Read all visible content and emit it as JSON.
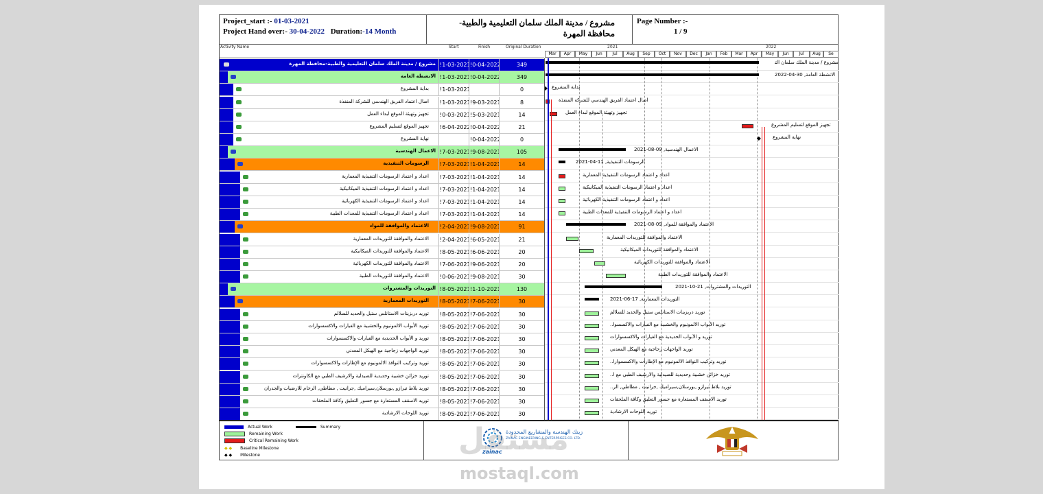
{
  "header": {
    "start_label": "Project_start  :-",
    "start_value": "01-03-2021",
    "handover_label": "Project Hand over:-",
    "handover_value": "30-04-2022",
    "duration_label": "Duration:",
    "duration_value": "-14 Month",
    "title": "مشروع / مدينة الملك سلمان التعليمية والطبية-محافظة المهرة",
    "page_label": "Page Number :-",
    "page_value": "1 / 9"
  },
  "columns": {
    "activity": "Activity Name",
    "start": "Start",
    "finish": "Finish",
    "duration": "Original Duration"
  },
  "timeline": {
    "years": [
      "2021",
      "2022"
    ],
    "months": [
      "Mar",
      "Apr",
      "May",
      "Jun",
      "Jul",
      "Aug",
      "Sep",
      "Oct",
      "Nov",
      "Dec",
      "Jan",
      "Feb",
      "Mar",
      "Apr",
      "May",
      "Jun",
      "Jul",
      "Aug",
      "Se"
    ]
  },
  "rows": [
    {
      "type": "project",
      "name": "مشروع / مدينة الملك سلمان التعليمية والطبية-محافظة المهرة",
      "start": "!1-03-2021",
      "finish": "!0-04-2022",
      "dur": "349"
    },
    {
      "type": "wbs1",
      "name": "الانشطة العامة",
      "start": "!1-03-2021",
      "finish": "!0-04-2022",
      "dur": "349"
    },
    {
      "type": "task",
      "name": "بداية المشروع",
      "start": "!1-03-2021",
      "finish": "",
      "dur": "0"
    },
    {
      "type": "task",
      "name": "اصال اعتماد الفريق الهندسي للشركة المنفذة",
      "start": "!1-03-2021",
      "finish": "!9-03-2021",
      "dur": "8"
    },
    {
      "type": "task",
      "name": "تجهيز وتهيئة الموقع لبداء العمل",
      "start": "!0-03-2021",
      "finish": "!5-03-2021",
      "dur": "14"
    },
    {
      "type": "task",
      "name": "تجهيز الموقع لتسليم المشروع",
      "start": "!6-04-2022",
      "finish": "!0-04-2022",
      "dur": "21"
    },
    {
      "type": "task",
      "name": "نهاية المشروع",
      "start": "",
      "finish": "!0-04-2022",
      "dur": "0"
    },
    {
      "type": "wbs1",
      "name": "الاعمال الهندسية",
      "start": "!7-03-2021",
      "finish": "!9-08-2021",
      "dur": "105"
    },
    {
      "type": "wbs2",
      "name": "الرسومات التنفيذية",
      "start": "!7-03-2021",
      "finish": "!1-04-2021",
      "dur": "14"
    },
    {
      "type": "task2",
      "name": "اعداد و اعتماد الرسومات التنفيذية المعمارية",
      "start": "!7-03-2021",
      "finish": "!1-04-2021",
      "dur": "14"
    },
    {
      "type": "task2",
      "name": "اعداد و اعتماد الرسومات التنفيذية الميكانيكية",
      "start": "!7-03-2021",
      "finish": "!1-04-2021",
      "dur": "14"
    },
    {
      "type": "task2",
      "name": "اعداد و اعتماد الرسومات التنفيذية الكهربائية",
      "start": "!7-03-2021",
      "finish": "!1-04-2021",
      "dur": "14"
    },
    {
      "type": "task2",
      "name": "اعداد و اعتماد الرسومات التنفيذية للمعدات الطبية",
      "start": "!7-03-2021",
      "finish": "!1-04-2021",
      "dur": "14"
    },
    {
      "type": "wbs2",
      "name": "الاعتماد والموافقة للمواد",
      "start": "!2-04-2021",
      "finish": "!9-08-2021",
      "dur": "91"
    },
    {
      "type": "task2",
      "name": "الاعتماد والموافقة للتوريدات المعمارية",
      "start": "!2-04-2021",
      "finish": "!6-05-2021",
      "dur": "21"
    },
    {
      "type": "task2",
      "name": "الاعتماد والموافقة للتوريدات الميكانيكية",
      "start": "!8-05-2021",
      "finish": "!6-06-2021",
      "dur": "20"
    },
    {
      "type": "task2",
      "name": "الاعتماد والموافقة للتوريدات الكهربائية",
      "start": "!7-06-2021",
      "finish": "!9-06-2021",
      "dur": "20"
    },
    {
      "type": "task2",
      "name": "الاعتماد والموافقة للتوريدات الطبية",
      "start": "!0-06-2021",
      "finish": "!9-08-2021",
      "dur": "30"
    },
    {
      "type": "wbs1",
      "name": "التوريدات والمشتروات",
      "start": "!8-05-2021",
      "finish": "!1-10-2021",
      "dur": "130"
    },
    {
      "type": "wbs2",
      "name": "التوريدات المعمارية",
      "start": "!8-05-2021",
      "finish": "!7-06-2021",
      "dur": "30"
    },
    {
      "type": "task2",
      "name": "توريد دربزينات الاستانلس ستيل والحديد للسلالم",
      "start": "!8-05-2021",
      "finish": "!7-06-2021",
      "dur": "30"
    },
    {
      "type": "task2",
      "name": "توريد الأبواب الالمونيوم والخشبية مع الفيارات والاكسسوارات",
      "start": "!8-05-2021",
      "finish": "!7-06-2021",
      "dur": "30"
    },
    {
      "type": "task2",
      "name": "توريد و الأبواب الحديدية مع الفيارات والاكسسوارات",
      "start": "!8-05-2021",
      "finish": "!7-06-2021",
      "dur": "30"
    },
    {
      "type": "task2",
      "name": "توريد الواجهات زجاجية مع الهيكل المعدني",
      "start": "!8-05-2021",
      "finish": "!7-06-2021",
      "dur": "30"
    },
    {
      "type": "task2",
      "name": "توريد وتركيب النوافذ الالمونيوم مع الإطارات والاكسسوارات",
      "start": "!8-05-2021",
      "finish": "!7-06-2021",
      "dur": "30"
    },
    {
      "type": "task2",
      "name": "توريد خزائن خشبية وحديدية للصيدلية والارشيف الطبي مع الكاونترات",
      "start": "!8-05-2021",
      "finish": "!7-06-2021",
      "dur": "30"
    },
    {
      "type": "task2",
      "name": "توريد بلاط تيرازو ,بورسلان,سيراميك ,جرانيت , مطاطي, الرخام للارضيات والجدران",
      "start": "!8-05-2021",
      "finish": "!7-06-2021",
      "dur": "30"
    },
    {
      "type": "task2",
      "name": "توريد الاسقف المستعارة مع جسور التعليق وكافة الملحقات",
      "start": "!8-05-2021",
      "finish": "!7-06-2021",
      "dur": "30"
    },
    {
      "type": "task2",
      "name": "توريد اللوحات الارشادية",
      "start": "!8-05-2021",
      "finish": "!7-06-2021",
      "dur": "30"
    }
  ],
  "gantt_labels": [
    "مشروع / مدينة الملك سلمان التعليمية والطبية, 30-04-2022",
    "الانشطة العامة, 30-04-2022",
    "بداية المشروع",
    "اصال اعتماد الفريق الهندسي للشركة المنفذة",
    "تجهيز وتهيئة الموقع لبداء العمل",
    "تجهيز الموقع لتسليم المشروع",
    "نهاية المشروع",
    "الاعمال الهندسية, 09-08-2021",
    "الرسومات التنفيذية, 11-04-2021",
    "اعداد و اعتماد الرسومات التنفيذية المعمارية",
    "اعداد و اعتماد الرسومات التنفيذية الميكانيكية",
    "اعداد و اعتماد الرسومات التنفيذية الكهربائية",
    "اعداد و اعتماد الرسومات التنفيذية للمعدات الطبية",
    "الاعتماد والموافقة للمواد, 09-08-2021",
    "الاعتماد والموافقة للتوريدات المعمارية",
    "الاعتماد والموافقة للتوريدات الميكانيكية",
    "الاعتماد والموافقة للتوريدات الكهربائية",
    "الاعتماد والموافقة للتوريدات الطبية",
    "التوريدات والمشتروات, 21-10-2021",
    "التوريدات المعمارية, 17-06-2021",
    "توريد دربزينات الاستانلس ستيل والحديد للسلالم",
    "توريد الأبواب الالمونيوم والخشبية مع الفيارات والاكسسوا..",
    "توريد و الأبواب الحديدية مع الفيارات والاكسسوارات",
    "توريد الواجهات زجاجية مع الهيكل المعدني",
    "توريد وتركيب النوافذ الالمونيوم مع الإطارات والاكسسوارا..",
    "توريد خزائن خشبية وحديدية للصيدلية والارشيف الطبي مع ا..",
    "توريد بلاط تيرازو ,بورسلان,سيراميك ,جرانيت , مطاطي, الر..",
    "توريد الاسقف المستعارة مع جسور التعليق وكافة الملحقات",
    "توريد اللوحات الارشادية"
  ],
  "legend": {
    "actual": "Actual Work",
    "remaining": "Remaining Work",
    "critical": "Critical Remaining Work",
    "baseline": "Baseline Milestone",
    "milestone": "Milestone",
    "summary": "Summary"
  },
  "footer": {
    "company_ar": "زينك الهندسة والمشاريع المحدودة",
    "company_en": "ZAINAC ENGINEERING & ENTERPRISES CO. LTD.",
    "brand": "zainac",
    "watermark_ar": "مستقل",
    "watermark_en": "mostaql.com"
  },
  "colors": {
    "blue": "#0000cc",
    "green_row": "#a7f5a2",
    "orange_row": "#ff8a00",
    "critical": "#e41b1b",
    "remaining": "#9ef29a"
  }
}
